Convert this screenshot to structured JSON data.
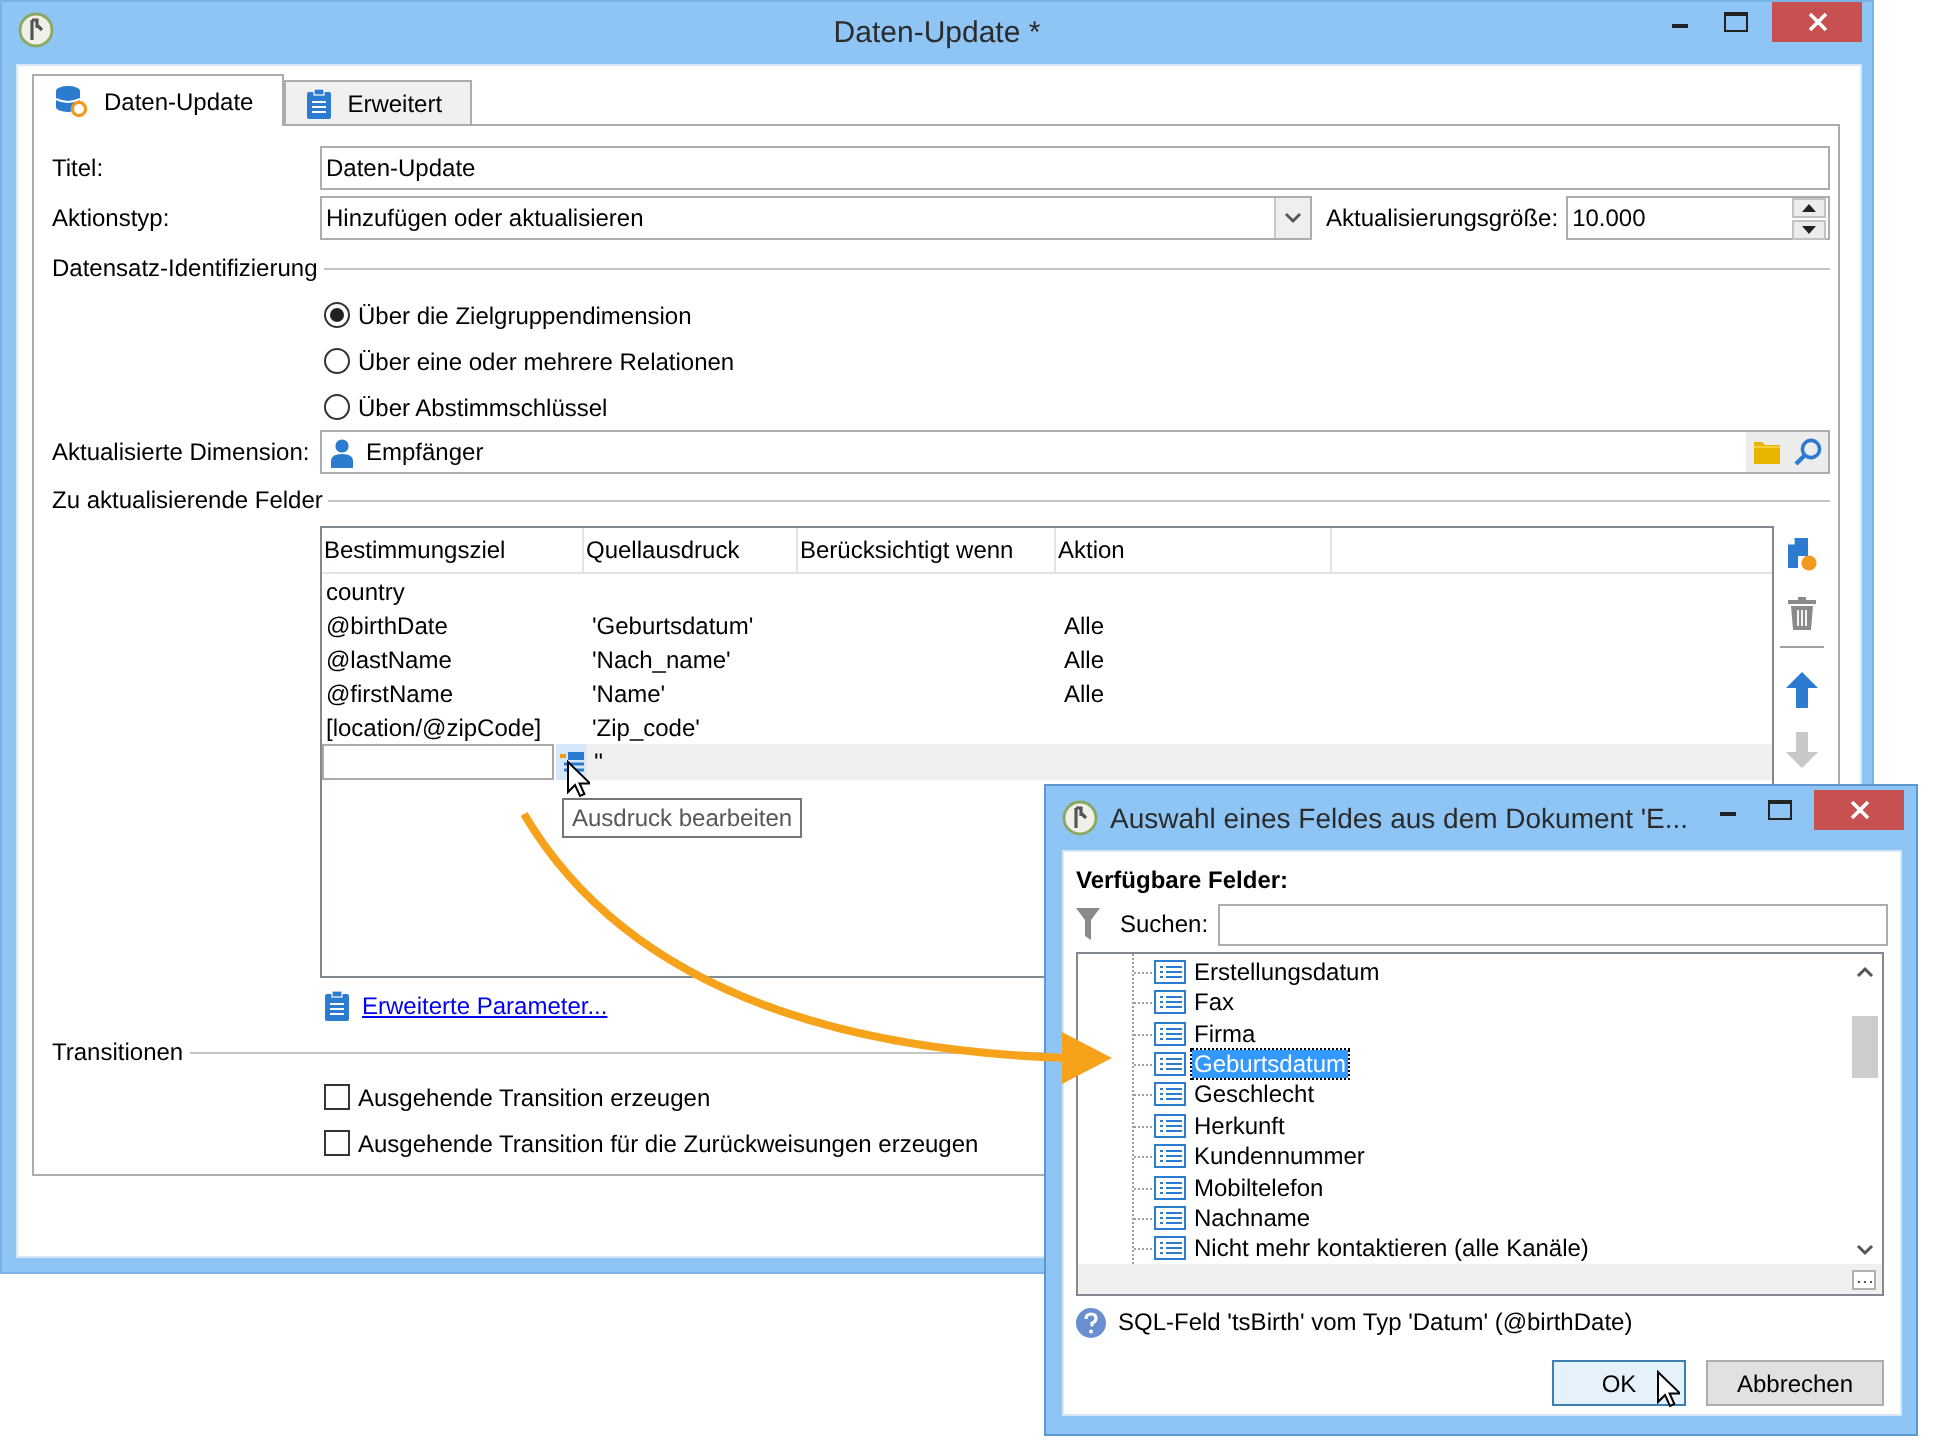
{
  "window": {
    "title": "Daten-Update *"
  },
  "tabs": [
    {
      "label": "Daten-Update",
      "kind": "database",
      "selected": true
    },
    {
      "label": "Erweitert",
      "kind": "clipboard",
      "selected": false
    }
  ],
  "form": {
    "title_label": "Titel:",
    "title_value": "Daten-Update",
    "action_type_label": "Aktionstyp:",
    "action_type_value": "Hinzufügen oder aktualisieren",
    "batch_size_label": "Aktualisierungsgröße:",
    "batch_size_value": "10.000"
  },
  "record_identification": {
    "heading": "Datensatz-Identifizierung",
    "options": [
      {
        "label": "Über die Zielgruppendimension",
        "selected": true
      },
      {
        "label": "Über eine oder mehrere Relationen",
        "selected": false
      },
      {
        "label": "Über Abstimmschlüssel",
        "selected": false
      }
    ]
  },
  "dimension": {
    "label": "Aktualisierte Dimension:",
    "value": "Empfänger"
  },
  "fields_section": {
    "heading": "Zu aktualisierende Felder",
    "columns": [
      "Bestimmungsziel",
      "Quellausdruck",
      "Berücksichtigt wenn",
      "Aktion"
    ],
    "rows": [
      {
        "kind": "field",
        "target": "country"
      },
      {
        "kind": "field",
        "target": "@birthDate",
        "source": "'Geburtsdatum'",
        "action": "Alle"
      },
      {
        "kind": "field",
        "target": "@lastName",
        "source": "'Nach_name'",
        "action": "Alle"
      },
      {
        "kind": "field",
        "target": "@firstName",
        "source": "'Name'",
        "action": "Alle"
      },
      {
        "kind": "field",
        "target": "[location/@zipCode]",
        "source": "'Zip_code'"
      },
      {
        "kind": "edit",
        "source": "''"
      }
    ],
    "tooltip": "Ausdruck bearbeiten",
    "toolbar": [
      {
        "kind": "add",
        "disabled": false
      },
      {
        "kind": "delete",
        "disabled": false
      },
      {
        "kind": "up",
        "disabled": false
      },
      {
        "kind": "down",
        "disabled": true
      }
    ],
    "advanced_link": "Erweiterte Parameter..."
  },
  "transitions": {
    "heading": "Transitionen",
    "options": [
      {
        "label": "Ausgehende Transition erzeugen",
        "checked": false
      },
      {
        "label": "Ausgehende Transition für die Zurückweisungen erzeugen",
        "checked": false
      }
    ]
  },
  "dialog": {
    "title": "Auswahl eines Feldes aus dem Dokument 'E...",
    "fields_label": "Verfügbare Felder:",
    "search_label": "Suchen:",
    "tree": [
      {
        "label": "Erstellungsdatum",
        "selected": false
      },
      {
        "label": "Fax",
        "selected": false
      },
      {
        "label": "Firma",
        "selected": false
      },
      {
        "label": "Geburtsdatum",
        "selected": true
      },
      {
        "label": "Geschlecht",
        "selected": false
      },
      {
        "label": "Herkunft",
        "selected": false
      },
      {
        "label": "Kundennummer",
        "selected": false
      },
      {
        "label": "Mobiltelefon",
        "selected": false
      },
      {
        "label": "Nachname",
        "selected": false
      },
      {
        "label": "Nicht mehr kontaktieren (alle Kanäle)",
        "selected": false
      }
    ],
    "info": "SQL-Feld 'tsBirth' vom Typ 'Datum' (@birthDate)",
    "buttons": [
      {
        "label": "OK",
        "default": true
      },
      {
        "label": "Abbrechen",
        "default": false
      }
    ]
  }
}
